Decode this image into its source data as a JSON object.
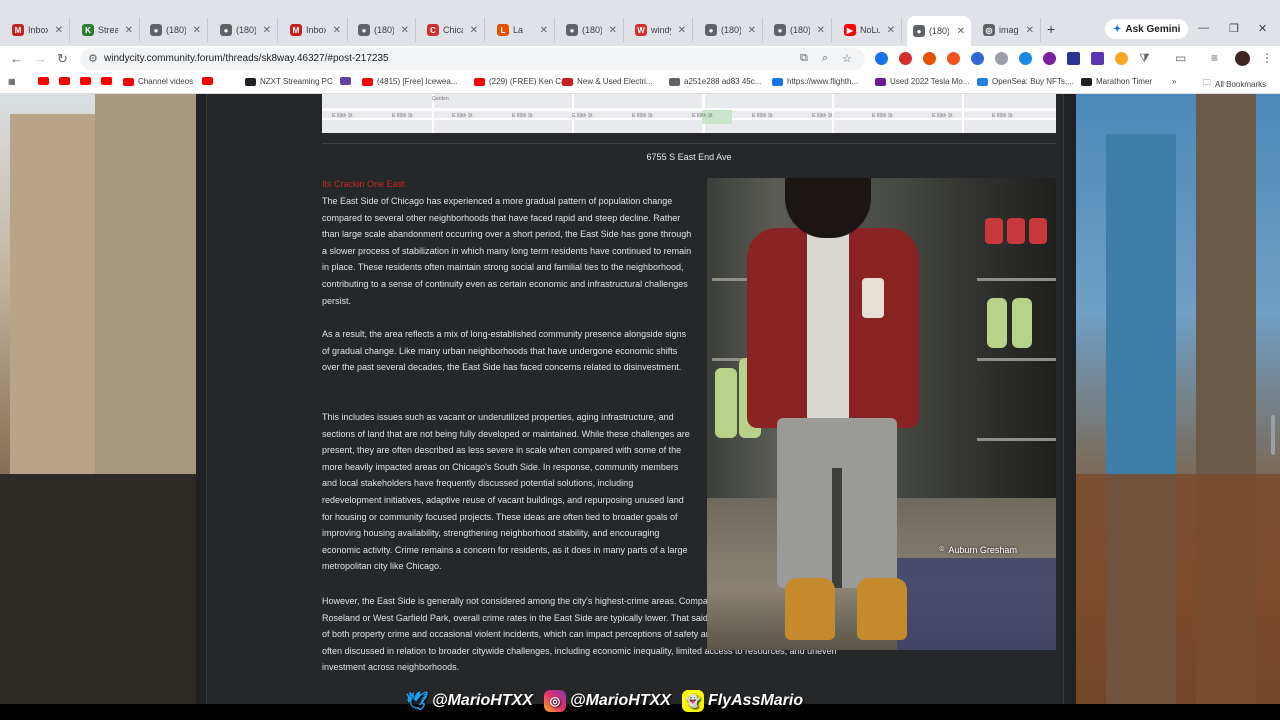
{
  "tabs": [
    {
      "label": "Inbox",
      "icon": "gmail-icon",
      "color": "#c5221f",
      "glyph": "M"
    },
    {
      "label": "Stream",
      "icon": "kick-icon",
      "color": "#2e7d32",
      "glyph": "K"
    },
    {
      "label": "(180)",
      "icon": "forum-icon",
      "color": "#5f6368",
      "glyph": "●"
    },
    {
      "label": "(180)",
      "icon": "forum-icon",
      "color": "#5f6368",
      "glyph": "●"
    },
    {
      "label": "Inbox",
      "icon": "gmail-icon",
      "color": "#c5221f",
      "glyph": "M"
    },
    {
      "label": "(180)",
      "icon": "forum-icon",
      "color": "#5f6368",
      "glyph": "●"
    },
    {
      "label": "Chica",
      "icon": "chicago-icon",
      "color": "#d32f2f",
      "glyph": "C"
    },
    {
      "label": "La",
      "icon": "la-icon",
      "color": "#e65100",
      "glyph": "L"
    },
    {
      "label": "(180)",
      "icon": "forum-icon",
      "color": "#5f6368",
      "glyph": "●"
    },
    {
      "label": "windy",
      "icon": "windy-icon",
      "color": "#d32f2f",
      "glyph": "W"
    },
    {
      "label": "(180)",
      "icon": "forum-icon",
      "color": "#5f6368",
      "glyph": "●"
    },
    {
      "label": "(180)",
      "icon": "forum-icon",
      "color": "#5f6368",
      "glyph": "●"
    },
    {
      "label": "NoLu",
      "icon": "youtube-icon",
      "color": "#ff0000",
      "glyph": "▶"
    },
    {
      "label": "(180)",
      "icon": "forum-icon",
      "color": "#5f6368",
      "glyph": "●"
    },
    {
      "label": "image",
      "icon": "globe-icon",
      "color": "#5f6368",
      "glyph": "◎"
    }
  ],
  "browser": {
    "gemini_label": "Ask Gemini",
    "url": "windycity.community.forum/threads/sk8way.46327/#post-217235"
  },
  "bookmarks": [
    {
      "label": "",
      "color": "#ff0000"
    },
    {
      "label": "",
      "color": "#ff0000"
    },
    {
      "label": "",
      "color": "#ff0000"
    },
    {
      "label": "",
      "color": "#ff0000"
    },
    {
      "label": "Channel videos",
      "color": "#ff0000"
    },
    {
      "label": "",
      "color": "#ff0000"
    },
    {
      "label": "NZXT Streaming PC",
      "color": "#202124"
    },
    {
      "label": "",
      "color": "#6441a5"
    },
    {
      "label": "(4815) [Free] Icewea...",
      "color": "#ff0000"
    },
    {
      "label": "(229) (FREE) Ken Car...",
      "color": "#ff0000"
    },
    {
      "label": "New & Used Electri...",
      "color": "#c5221f"
    },
    {
      "label": "a251e288 ad83 45c...",
      "color": "#5f6368"
    },
    {
      "label": "https://www.flighth...",
      "color": "#1a73e8"
    },
    {
      "label": "Used 2022 Tesla Mo...",
      "color": "#6a1b9a"
    },
    {
      "label": "OpenSea: Buy NFTs,...",
      "color": "#2081e2"
    },
    {
      "label": "Marathon Timer",
      "color": "#202124"
    }
  ],
  "all_bookmarks_label": "All Bookmarks",
  "map_streets": [
    "E 69th St",
    "E 69th St",
    "E 69th St",
    "E 69th St",
    "E 69th St",
    "E 69th St",
    "E 69th St",
    "E 69th St",
    "E 69th St",
    "E 69th St",
    "E 69th St",
    "E 69th St"
  ],
  "map_park_label": "Garden",
  "post": {
    "caption": "6755 S East End Ave",
    "title": "Its Crackin One East",
    "paragraphs": [
      "The East Side of Chicago has experienced a more gradual pattern of population change compared to several other neighborhoods that have faced rapid and steep decline. Rather than large scale abandonment occurring over a short period, the East Side has gone through a slower process of stabilization in which many long term residents have continued to remain in place. These residents often maintain strong social and familial ties to the neighborhood, contributing to a sense of continuity even as certain economic and infrastructural challenges persist.",
      "As a result, the area reflects a mix of long-established community presence alongside signs of gradual change. Like many urban neighborhoods that have undergone economic shifts over the past several decades, the East Side has faced concerns related to disinvestment.",
      "This includes issues such as vacant or underutilized properties, aging infrastructure, and sections of land that are not being fully developed or maintained. While these challenges are present, they are often described as less severe in scale when compared with some of the more heavily impacted areas on Chicago's South Side. In response, community members and local stakeholders have frequently discussed potential solutions, including redevelopment initiatives, adaptive reuse of vacant buildings, and repurposing unused land for housing or community focused projects. These ideas are often tied to broader goals of improving housing availability, strengthening neighborhood stability, and encouraging economic activity. Crime remains a concern for residents, as it does in many parts of a large metropolitan city like Chicago.",
      "However, the East Side is generally not considered among the city's highest-crime areas. Compared with neighborhoods such as Roseland or West Garfield Park, overall crime rates in the East Side are typically lower. That said, residents still experience the effects of both property crime and occasional violent incidents, which can impact perceptions of safety and quality of life. These issues are often discussed in relation to broader citywide challenges, including economic inequality, limited access to resources, and uneven investment across neighborhoods."
    ],
    "photo_location": "Auburn Gresham"
  },
  "social": {
    "twitter": "@MarioHTXX",
    "instagram": "@MarioHTXX",
    "snapchat": "FlyAssMario"
  }
}
